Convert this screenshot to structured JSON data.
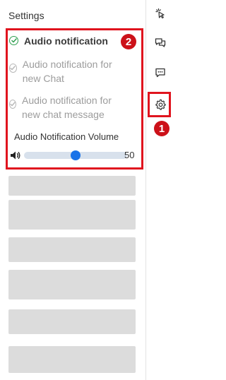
{
  "panel": {
    "title": "Settings"
  },
  "notifications": {
    "items": [
      {
        "label": "Audio notification",
        "state": "enabled"
      },
      {
        "label": "Audio notification for new Chat",
        "state": "disabled"
      },
      {
        "label": "Audio notification for new chat message",
        "state": "disabled"
      }
    ]
  },
  "volume": {
    "label": "Audio Notification Volume",
    "value": "50",
    "level": 0.5
  },
  "annotations": {
    "badge_1": "1",
    "badge_2": "2"
  },
  "rail": {
    "icons": [
      "cursor-click-icon",
      "chat-bubbles-icon",
      "chat-message-icon",
      "gear-icon"
    ]
  },
  "colors": {
    "highlight": "#e0141e",
    "badge": "#cc1119",
    "slider_thumb": "#1a73e8",
    "check_enabled": "#2e9e4f"
  }
}
